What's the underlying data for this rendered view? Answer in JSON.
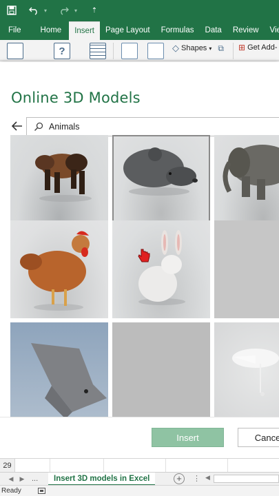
{
  "quick_access": {
    "icons": [
      "save-icon",
      "undo-icon",
      "redo-icon",
      "customize-icon"
    ]
  },
  "ribbon": {
    "tabs": [
      {
        "label": "File",
        "active": false
      },
      {
        "label": "Home",
        "active": false
      },
      {
        "label": "Insert",
        "active": true
      },
      {
        "label": "Page Layout",
        "active": false
      },
      {
        "label": "Formulas",
        "active": false
      },
      {
        "label": "Data",
        "active": false
      },
      {
        "label": "Review",
        "active": false
      },
      {
        "label": "View",
        "active": false
      }
    ],
    "shapes_label": "Shapes",
    "get_addins_label": "Get Add-"
  },
  "dialog": {
    "title": "Online 3D Models",
    "search_value": "Animals",
    "models": [
      {
        "name": "bear",
        "selected": false
      },
      {
        "name": "mouse",
        "selected": true
      },
      {
        "name": "elephant",
        "selected": false
      },
      {
        "name": "chicken",
        "selected": false
      },
      {
        "name": "rabbit",
        "selected": false
      },
      {
        "name": "loading",
        "selected": false
      },
      {
        "name": "bat",
        "selected": false
      },
      {
        "name": "loading",
        "selected": false
      },
      {
        "name": "flamingo",
        "selected": false
      }
    ],
    "insert_label": "Insert",
    "cancel_label": "Cancel"
  },
  "sheet": {
    "row_number": "29",
    "tab_label": "Insert 3D models in Excel",
    "more_tabs": "..."
  },
  "status": {
    "text": "Ready"
  },
  "colors": {
    "brand": "#217346",
    "insert_disabled": "#8fc3a3"
  }
}
